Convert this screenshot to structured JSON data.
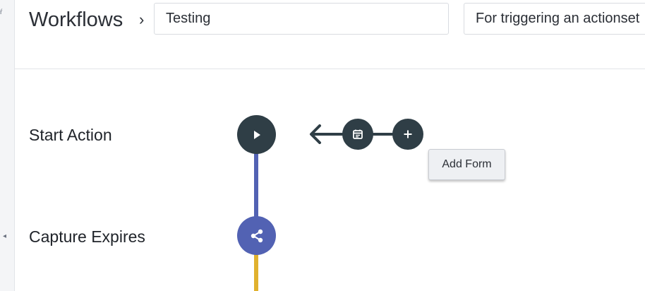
{
  "header": {
    "title": "Workflows",
    "chevron": "›",
    "workflow_name": "Testing",
    "workflow_description": "For triggering an actionset"
  },
  "sidebar": {
    "corner_glyph": "ŕ",
    "collapse_icon": "◂"
  },
  "steps": [
    {
      "label": "Start Action",
      "icon": "play-icon",
      "color": "#2f3e46"
    },
    {
      "label": "Capture Expires",
      "icon": "share-icon",
      "color": "#5262b3"
    }
  ],
  "branch": {
    "form_icon": "calendar-icon",
    "add_icon": "plus-icon",
    "tooltip": "Add Form"
  },
  "colors": {
    "dark_node": "#2f3e46",
    "blue_connector": "#5262b3",
    "yellow_connector": "#e0b12e"
  }
}
